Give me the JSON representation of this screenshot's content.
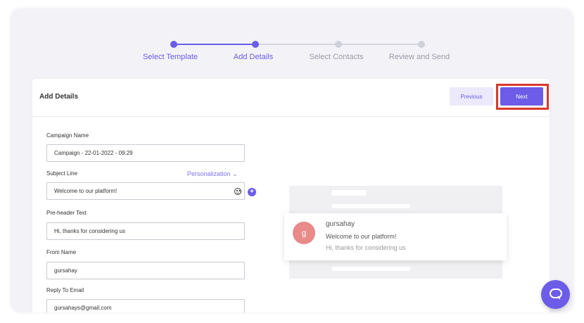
{
  "stepper": {
    "steps": [
      {
        "label": "Select Template",
        "state": "done"
      },
      {
        "label": "Add Details",
        "state": "current"
      },
      {
        "label": "Select Contacts",
        "state": "pending"
      },
      {
        "label": "Review and Send",
        "state": "pending"
      }
    ]
  },
  "card": {
    "title": "Add Details",
    "previous_label": "Previous",
    "next_label": "Next"
  },
  "form": {
    "campaign_name": {
      "label": "Campaign Name",
      "value": "Campaign - 22-01-2022 - 09:29"
    },
    "subject_line": {
      "label": "Subject Line",
      "value": "Welcome to our platform!"
    },
    "personalization_label": "Personalization",
    "preheader": {
      "label": "Pre-header Text",
      "value": "Hi, thanks for considering us"
    },
    "from_name": {
      "label": "From Name",
      "value": "gursahay"
    },
    "reply_to": {
      "label": "Reply To Email",
      "value": "gursahays@gmail.com"
    }
  },
  "preview": {
    "avatar_letter": "g",
    "sender": "gursahay",
    "subject": "Welcome to our platform!",
    "preheader": "Hi, thanks for considering us"
  },
  "colors": {
    "accent": "#6c5ce7",
    "highlight": "#d9382c",
    "avatar": "#e8898a"
  }
}
